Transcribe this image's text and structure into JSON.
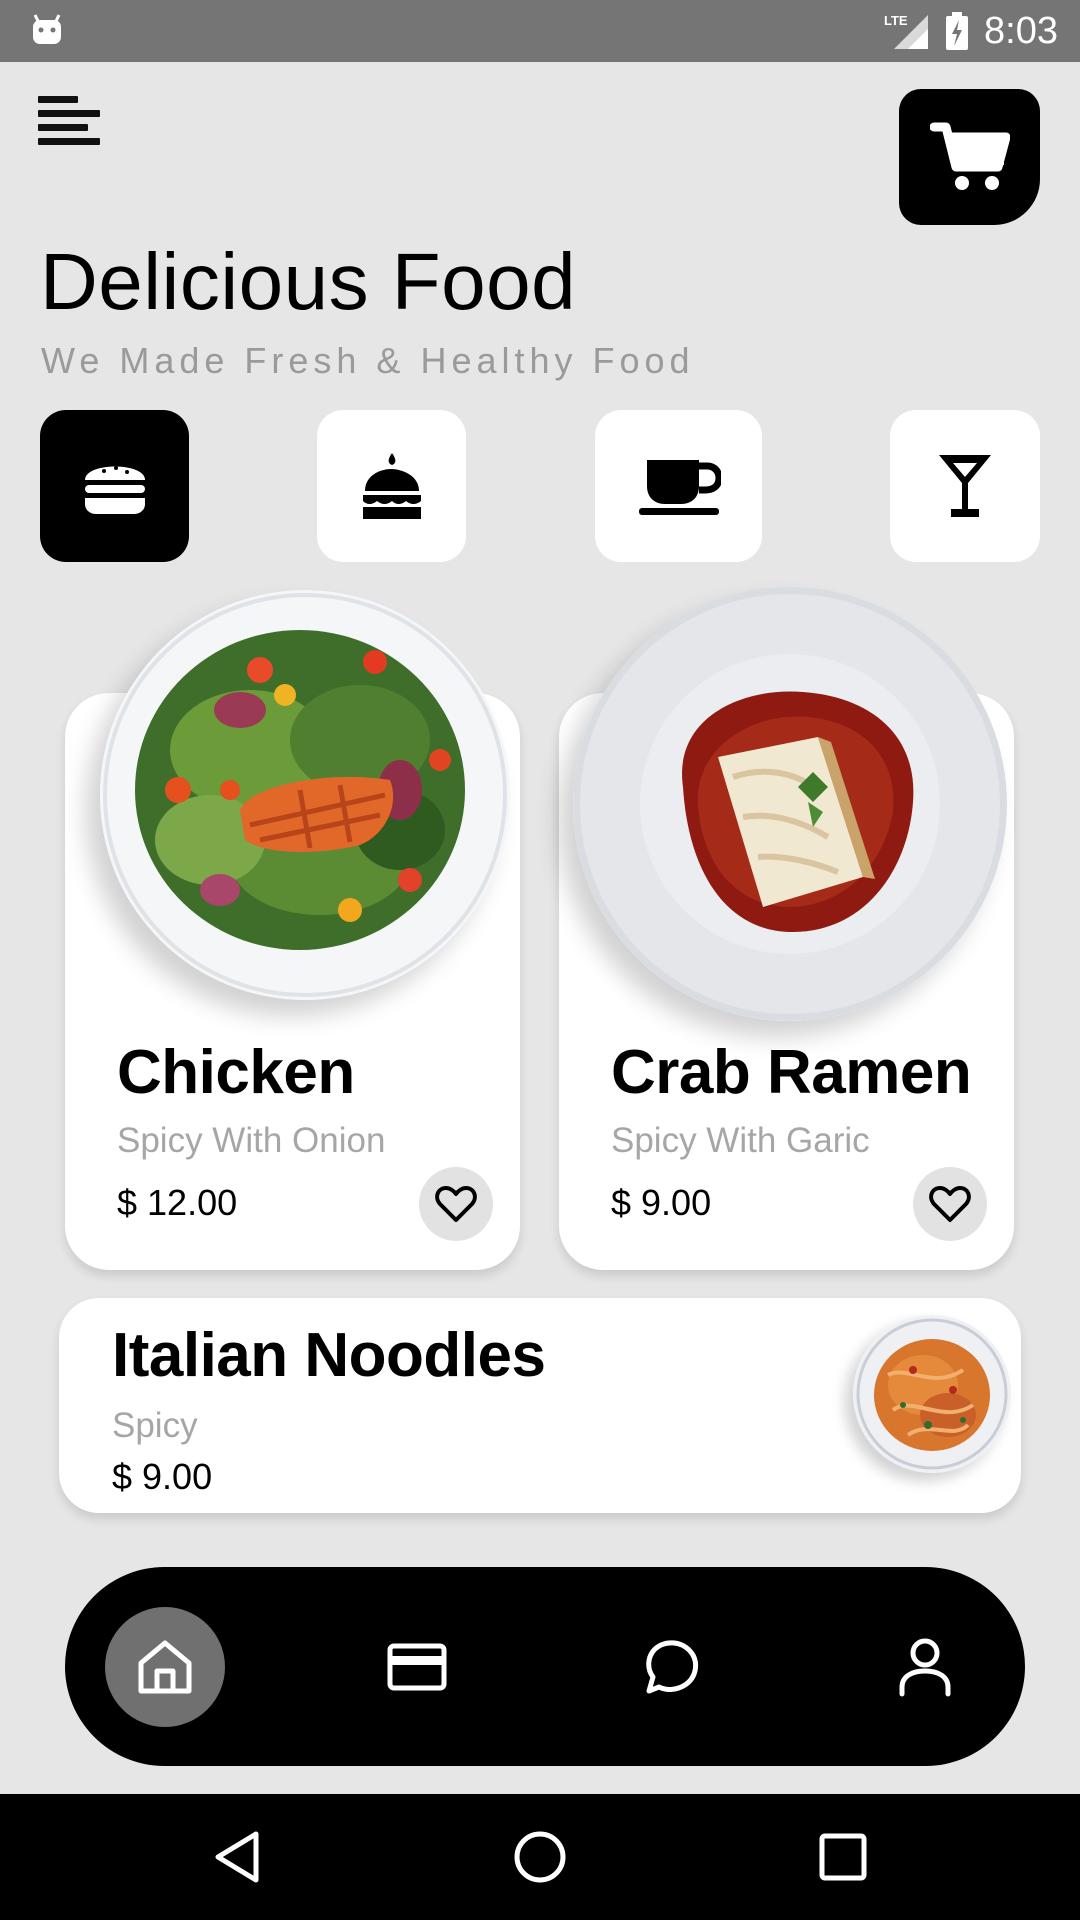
{
  "status_bar": {
    "time": "8:03",
    "network": "LTE"
  },
  "header": {
    "menu_icon": "menu-icon",
    "cart_icon": "cart-icon",
    "title": "Delicious Food",
    "subtitle": "We Made Fresh & Healthy Food"
  },
  "categories": [
    {
      "icon": "burger-icon",
      "active": true
    },
    {
      "icon": "cake-icon",
      "active": false
    },
    {
      "icon": "coffee-cup-icon",
      "active": false
    },
    {
      "icon": "cocktail-icon",
      "active": false
    }
  ],
  "featured": [
    {
      "name": "Chicken",
      "desc": "Spicy With Onion",
      "price": "$ 12.00",
      "image": "salmon-salad-plate"
    },
    {
      "name": "Crab Ramen",
      "desc": "Spicy With Garic",
      "price": "$ 9.00",
      "image": "lasagna-plate"
    }
  ],
  "list_item": {
    "name": "Italian Noodles",
    "desc": "Spicy",
    "price": "$ 9.00",
    "image": "pasta-plate"
  },
  "bottom_nav": [
    {
      "icon": "home-icon",
      "active": true
    },
    {
      "icon": "card-icon",
      "active": false
    },
    {
      "icon": "chat-icon",
      "active": false
    },
    {
      "icon": "profile-icon",
      "active": false
    }
  ],
  "colors": {
    "background": "#e6e6e6",
    "accent": "#000000",
    "muted_text": "#a6a6a6"
  }
}
